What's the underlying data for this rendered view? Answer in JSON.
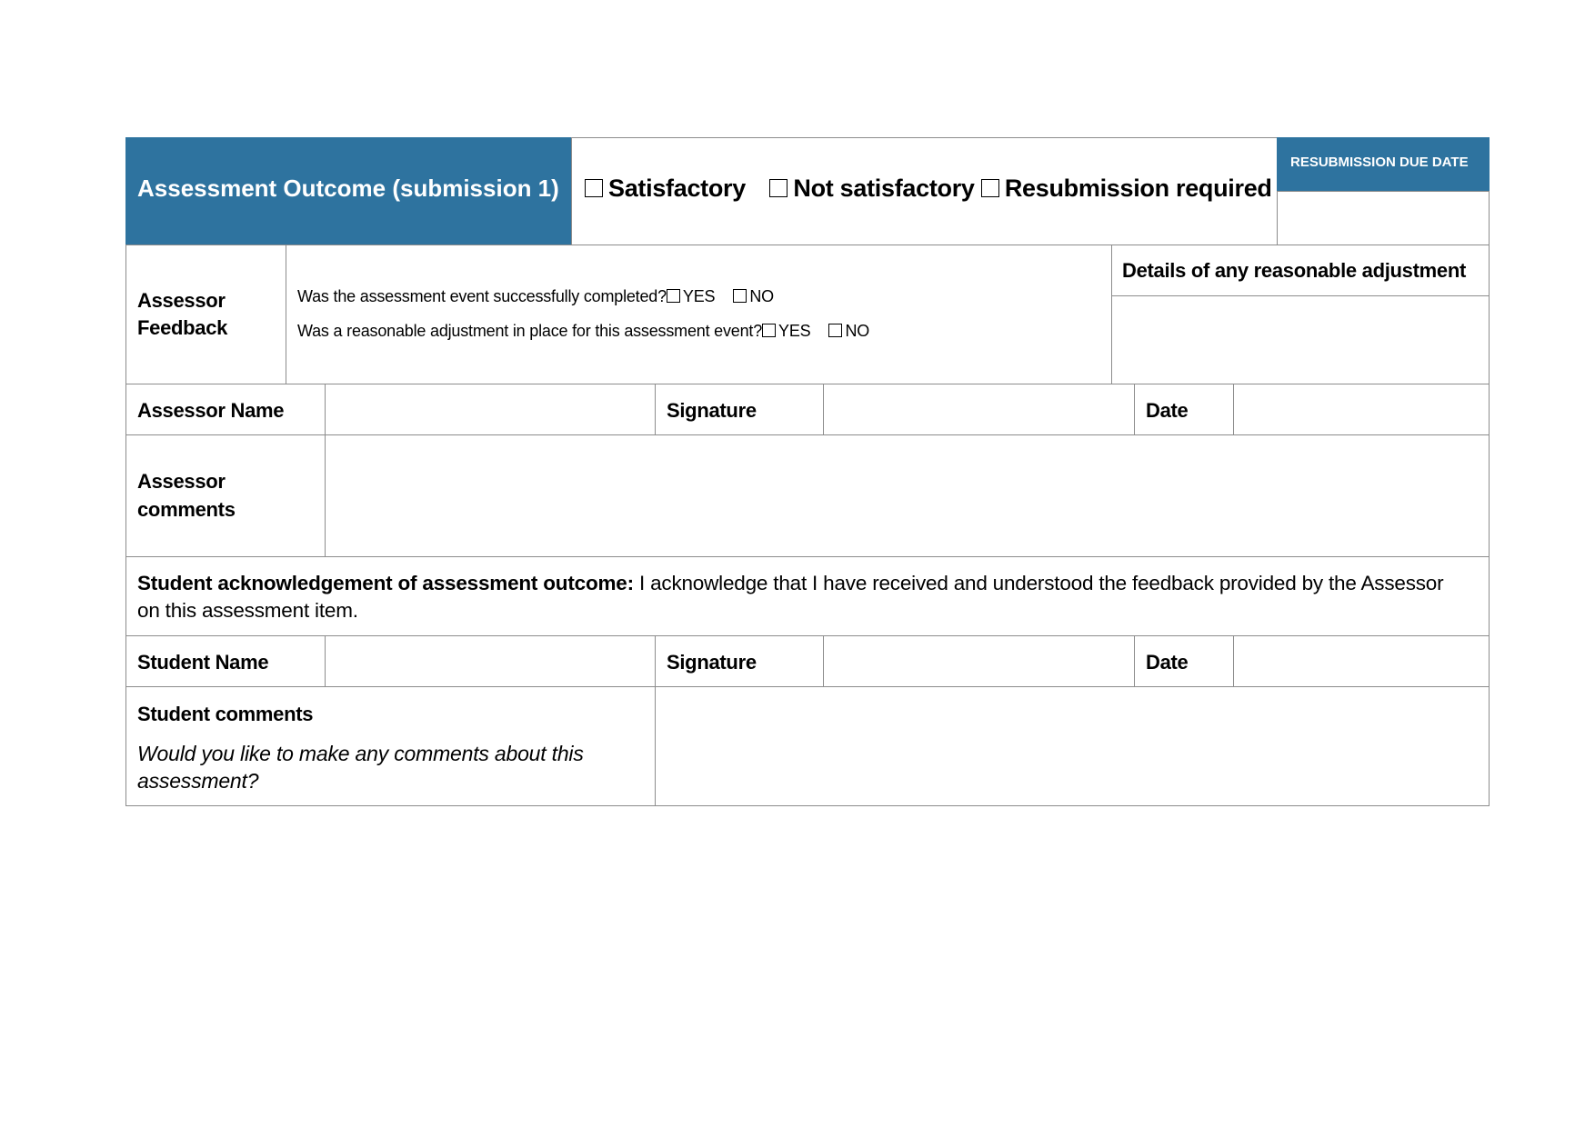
{
  "header": {
    "title": "Assessment Outcome (submission 1)",
    "options": [
      {
        "label": "Satisfactory",
        "checked": false
      },
      {
        "label": "Not satisfactory",
        "checked": false
      },
      {
        "label": "Resubmission required",
        "checked": false
      }
    ],
    "resubmission_due_label": "RESUBMISSION DUE DATE",
    "resubmission_due_value": ""
  },
  "feedback": {
    "label_line1": "Assessor",
    "label_line2": "Feedback",
    "questions": [
      {
        "text": "Was the assessment event successfully completed?",
        "yes": "YES",
        "no": "NO"
      },
      {
        "text": "Was a reasonable adjustment in place for this assessment event?",
        "yes": "YES",
        "no": "NO"
      }
    ],
    "adjustment_label": "Details of any reasonable adjustment",
    "adjustment_value": ""
  },
  "assessor_row": {
    "name_label": "Assessor Name",
    "name_value": "",
    "signature_label": "Signature",
    "signature_value": "",
    "date_label": "Date",
    "date_value": ""
  },
  "assessor_comments": {
    "label_line1": "Assessor",
    "label_line2": "comments",
    "value": ""
  },
  "acknowledgement": {
    "bold": "Student acknowledgement of assessment outcome:",
    "text": " I acknowledge that I have received and understood the feedback provided by the Assessor",
    "text_line2": "on this assessment item."
  },
  "student_row": {
    "name_label": "Student Name",
    "name_value": "",
    "signature_label": "Signature",
    "signature_value": "",
    "date_label": "Date",
    "date_value": ""
  },
  "student_comments": {
    "label": "Student comments",
    "prompt_line1": "Would you like to make any comments about this",
    "prompt_line2": "assessment?",
    "value": ""
  },
  "colors": {
    "accent": "#2e739f",
    "border": "#8c8c8c"
  }
}
